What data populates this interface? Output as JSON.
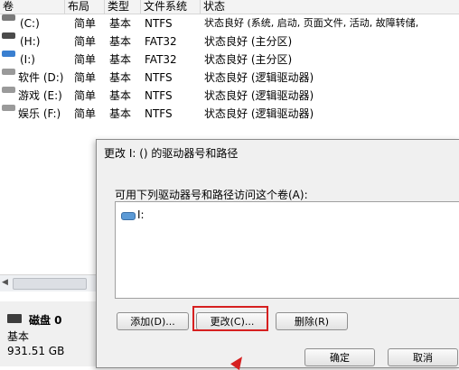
{
  "table": {
    "headers": [
      "卷",
      "布局",
      "类型",
      "文件系统",
      "状态"
    ],
    "rows": [
      {
        "volume": "(C:)",
        "layout": "简单",
        "type": "基本",
        "fs": "NTFS",
        "status": "状态良好 (系统, 启动, 页面文件, 活动, 故障转储,",
        "icon_color": "#7a7a7a"
      },
      {
        "volume": "(H:)",
        "layout": "简单",
        "type": "基本",
        "fs": "FAT32",
        "status": "状态良好 (主分区)",
        "icon_color": "#4a4a4a"
      },
      {
        "volume": "(I:)",
        "layout": "简单",
        "type": "基本",
        "fs": "FAT32",
        "status": "状态良好 (主分区)",
        "icon_color": "#3a7fd0"
      },
      {
        "volume": "软件 (D:)",
        "layout": "简单",
        "type": "基本",
        "fs": "NTFS",
        "status": "状态良好 (逻辑驱动器)",
        "icon_color": "#9a9a9a"
      },
      {
        "volume": "游戏 (E:)",
        "layout": "简单",
        "type": "基本",
        "fs": "NTFS",
        "status": "状态良好 (逻辑驱动器)",
        "icon_color": "#9a9a9a"
      },
      {
        "volume": "娱乐 (F:)",
        "layout": "简单",
        "type": "基本",
        "fs": "NTFS",
        "status": "状态良好 (逻辑驱动器)",
        "icon_color": "#9a9a9a"
      }
    ]
  },
  "disk_panel": {
    "name": "磁盘 0",
    "type": "基本",
    "size": "931.51 GB"
  },
  "dialog": {
    "title": "更改 I: () 的驱动器号和路径",
    "label": "可用下列驱动器号和路径访问这个卷(A):",
    "list_items": [
      "I:"
    ],
    "buttons": {
      "add": "添加(D)...",
      "change": "更改(C)...",
      "delete": "删除(R)",
      "ok": "确定",
      "cancel": "取消"
    }
  },
  "accent_color": "#d62020"
}
